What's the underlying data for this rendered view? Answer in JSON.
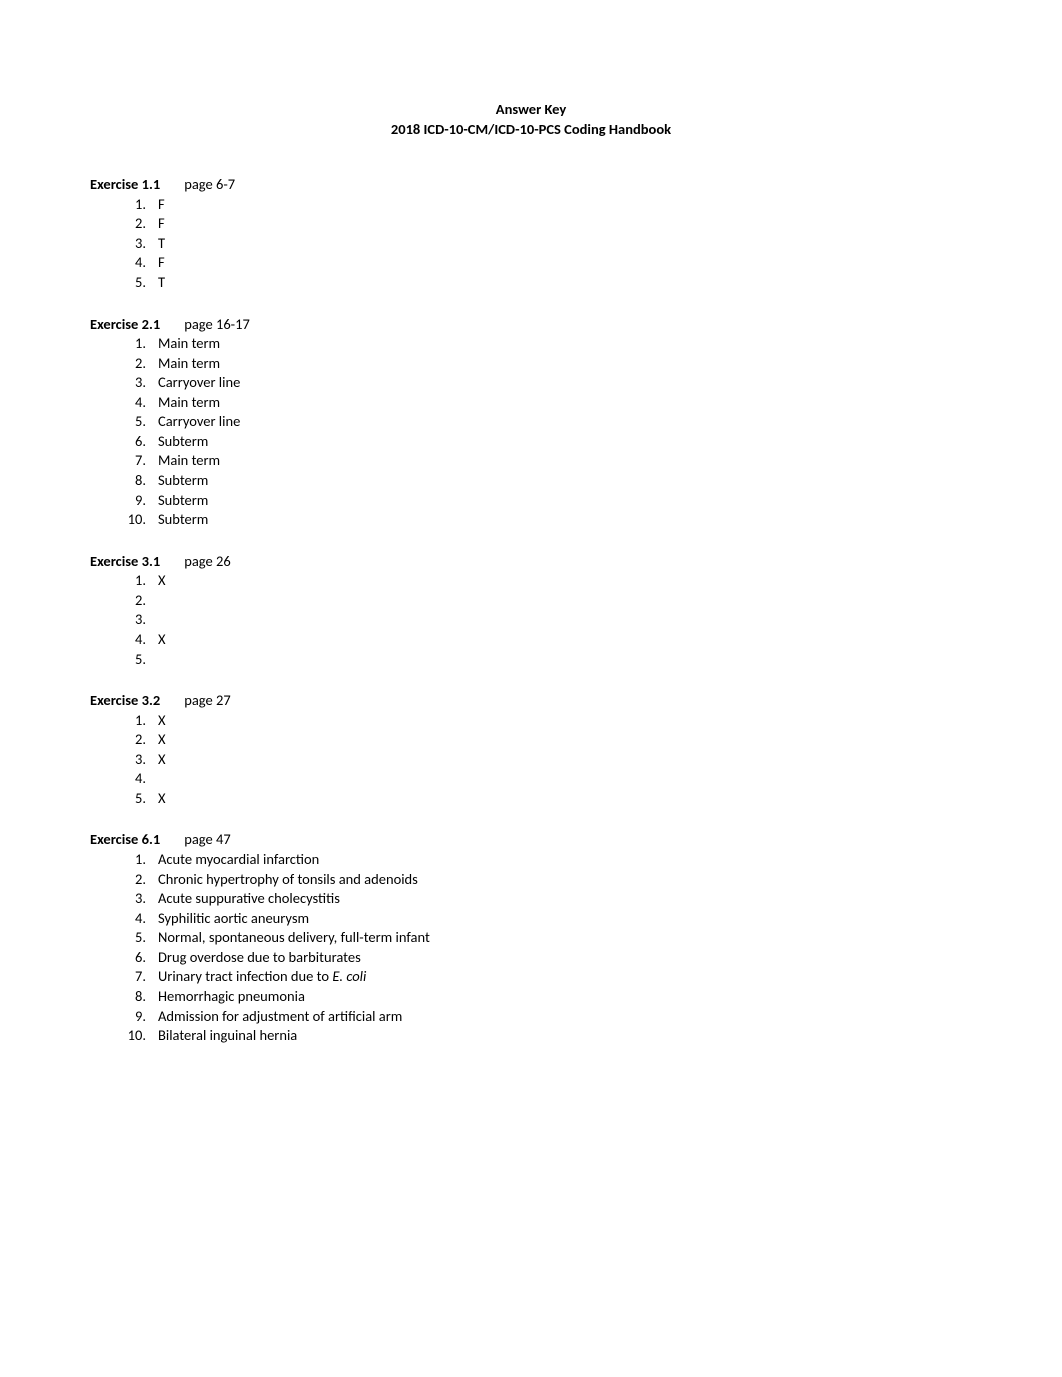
{
  "title_line1": "Answer Key",
  "title_line2": "2018 ICD-10-CM/ICD-10-PCS Coding Handbook",
  "exercises": [
    {
      "label": "Exercise 1.1",
      "page": "page 6-7",
      "items": [
        "F",
        "F",
        "T",
        "F",
        "T"
      ]
    },
    {
      "label": "Exercise 2.1",
      "page": "page 16-17",
      "items": [
        "Main term",
        "Main term",
        "Carryover line",
        "Main term",
        "Carryover line",
        "Subterm",
        "Main term",
        "Subterm",
        "Subterm",
        "Subterm"
      ]
    },
    {
      "label": "Exercise 3.1",
      "page": "page 26",
      "items": [
        "X",
        "",
        "",
        "X",
        ""
      ]
    },
    {
      "label": "Exercise 3.2",
      "page": "page 27",
      "items": [
        "X",
        "X",
        "X",
        "",
        "X"
      ]
    },
    {
      "label": "Exercise 6.1",
      "page": "page 47",
      "items": [
        "Acute myocardial infarction",
        "Chronic hypertrophy of tonsils and adenoids",
        "Acute suppurative cholecystitis",
        "Syphilitic aortic aneurysm",
        "Normal, spontaneous delivery, full-term infant",
        "Drug overdose due to barbiturates",
        {
          "prefix": "Urinary tract infection due to ",
          "italic": "E. coli"
        },
        "Hemorrhagic pneumonia",
        "Admission for adjustment of artificial arm",
        "Bilateral inguinal hernia"
      ]
    }
  ]
}
